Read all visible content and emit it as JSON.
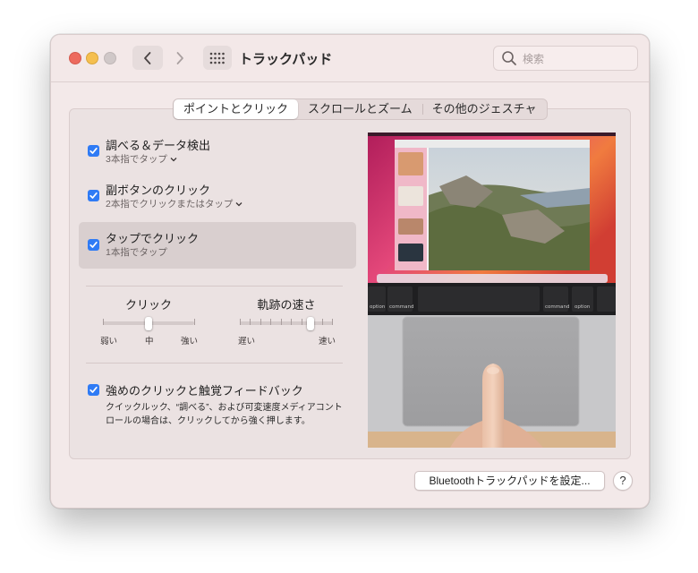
{
  "window": {
    "title": "トラックパッド"
  },
  "search": {
    "placeholder": "検索"
  },
  "tabs": [
    {
      "label": "ポイントとクリック",
      "active": true
    },
    {
      "label": "スクロールとズーム",
      "active": false
    },
    {
      "label": "その他のジェスチャ",
      "active": false
    }
  ],
  "options": [
    {
      "label": "調べる＆データ検出",
      "sub": "3本指でタップ",
      "checked": true
    },
    {
      "label": "副ボタンのクリック",
      "sub": "2本指でクリックまたはタップ",
      "checked": true
    },
    {
      "label": "タップでクリック",
      "sub": "1本指でタップ",
      "checked": true
    }
  ],
  "click_slider": {
    "title": "クリック",
    "min_label": "弱い",
    "mid_label": "中",
    "max_label": "強い",
    "value": 0.5
  },
  "tracking_slider": {
    "title": "軌跡の速さ",
    "min_label": "遅い",
    "max_label": "速い",
    "value": 0.7
  },
  "force_click": {
    "label": "強めのクリックと触覚フィードバック",
    "checked": true,
    "description": "クイックルック、“調べる”、および可変速度メディアコントロールの場合は、クリックしてから強く押します。"
  },
  "preview": {
    "key_option_left": "option",
    "key_command_left": "command",
    "key_command_right": "command",
    "key_option_right": "option"
  },
  "buttons": {
    "bluetooth": "Bluetoothトラックパッドを設定...",
    "help": "?"
  },
  "colors": {
    "accent": "#2f7bf5",
    "close": "#ed6a5e",
    "minimize": "#f5bf4f",
    "zoom_disabled": "#d0c8c8"
  }
}
